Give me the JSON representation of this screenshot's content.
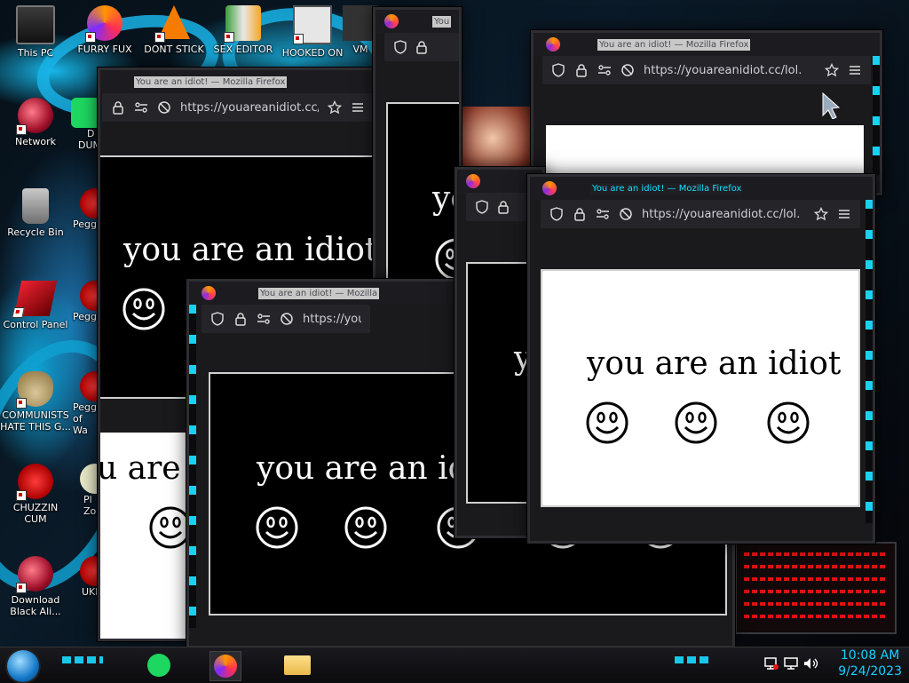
{
  "desktop": {
    "icons": [
      {
        "label": "This PC",
        "icon": "pc-icon"
      },
      {
        "label": "FURRY FUX",
        "icon": "firefox-icon"
      },
      {
        "label": "DONT STICK",
        "icon": "vlc-icon"
      },
      {
        "label": "SEX EDITOR",
        "icon": "hxd-icon"
      },
      {
        "label": "HOOKED ON",
        "icon": "maze-icon"
      },
      {
        "label": "VM",
        "icon": "vm-icon"
      },
      {
        "label": "Network",
        "icon": "network-icon"
      },
      {
        "label": "Recycle Bin",
        "icon": "recycle-bin-icon"
      },
      {
        "label": "Control Panel",
        "icon": "control-panel-icon"
      },
      {
        "label": "COMMUNISTS HATE THIS G...",
        "icon": "money-bag-icon"
      },
      {
        "label": "CHUZZIN CUM",
        "icon": "chuzzle-icon"
      },
      {
        "label": "Download Black Ali...",
        "icon": "download-icon"
      },
      {
        "label": "D",
        "icon": "spotify-icon"
      },
      {
        "label": "DUM",
        "icon": "spotify-icon"
      },
      {
        "label": "Pegg",
        "icon": "peggle-icon"
      },
      {
        "label": "Pegg",
        "icon": "peggle-icon"
      },
      {
        "label": "Pegg",
        "icon": "peggle-icon"
      },
      {
        "label": "of Wa",
        "icon": "peggle-icon"
      },
      {
        "label": "Pl",
        "icon": "plants-icon"
      },
      {
        "label": "Zo",
        "icon": "plants-icon"
      },
      {
        "label": "UKP",
        "icon": "ukp-icon"
      }
    ]
  },
  "browser": {
    "title": "You are an idiot! — Mozilla Firefox",
    "title_short": "You are an idiot! — Mozilla",
    "title_stub": "You",
    "url": "https://youareanidiot.cc/lol.",
    "url_short": "https://you",
    "message": "you are an idiot",
    "message_partial_a": "u are a",
    "message_partial_b": "you are an idio",
    "message_partial_c": "yo",
    "message_partial_d": "y",
    "icons": [
      "shield-icon",
      "lock-icon",
      "permissions-icon",
      "tracking-icon",
      "star-icon",
      "menu-icon"
    ]
  },
  "taskbar": {
    "apps": [
      "spotify-icon",
      "firefox-icon",
      "file-explorer-icon"
    ],
    "tray": [
      "network-icon",
      "display-icon",
      "volume-icon"
    ],
    "time": "10:08 AM",
    "date": "9/24/2023"
  },
  "colors": {
    "accent_cyan": "#16d0ff",
    "window_frame": "#1a1a1d",
    "content_dark": "#000000",
    "content_light": "#ffffff"
  }
}
